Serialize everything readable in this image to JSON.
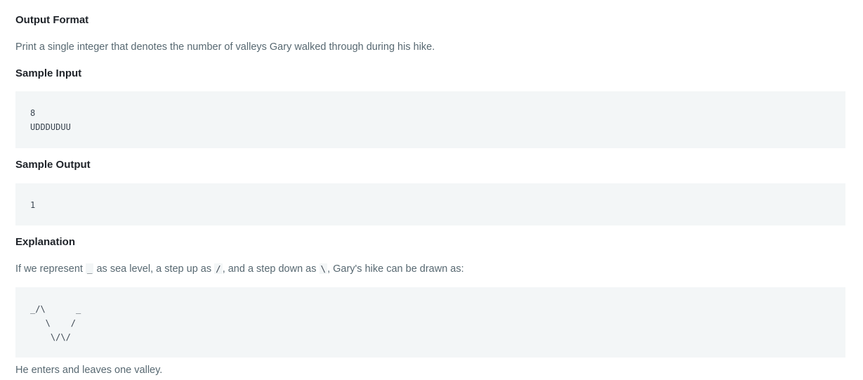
{
  "sections": {
    "output_format": {
      "heading": "Output Format",
      "text": "Print a single integer that denotes the number of valleys Gary walked through during his hike."
    },
    "sample_input": {
      "heading": "Sample Input",
      "lines": [
        "8",
        "UDDDUDUU"
      ]
    },
    "sample_output": {
      "heading": "Sample Output",
      "lines": [
        "1"
      ]
    },
    "explanation": {
      "heading": "Explanation",
      "text_part1": "If we represent ",
      "code_sea": "_",
      "text_part2": " as sea level, a step up as ",
      "code_up": "/",
      "text_part3": ", and a step down as ",
      "code_down": "\\",
      "text_part4": ", Gary's hike can be drawn as:",
      "diagram_lines": [
        "_/\\      _",
        "   \\    /",
        "    \\/\\/"
      ],
      "closing": "He enters and leaves one valley."
    }
  }
}
